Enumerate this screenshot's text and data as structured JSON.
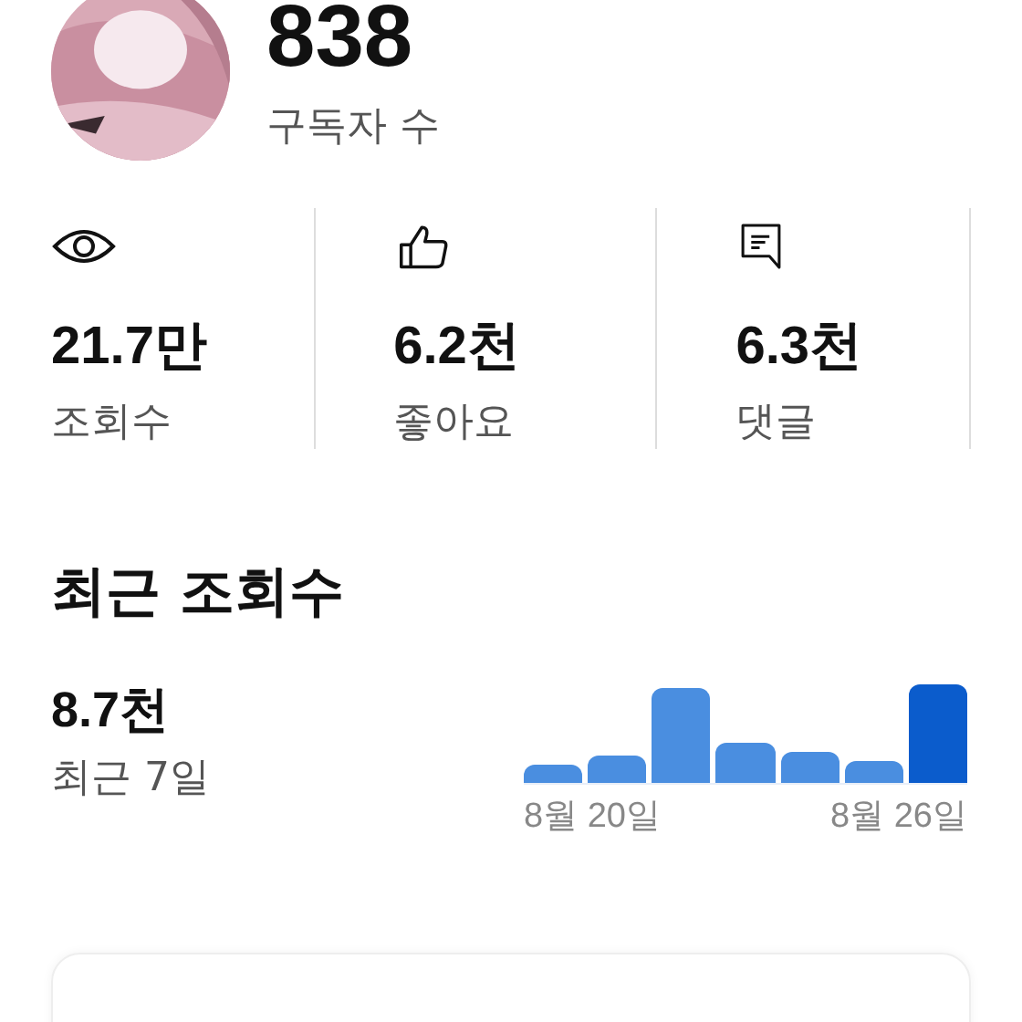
{
  "channel": {
    "subscribers": "838",
    "subscribers_label": "구독자 수"
  },
  "stats": [
    {
      "kind": "views",
      "value": "21.7만",
      "label": "조회수"
    },
    {
      "kind": "likes",
      "value": "6.2천",
      "label": "좋아요"
    },
    {
      "kind": "comments",
      "value": "6.3천",
      "label": "댓글"
    }
  ],
  "recent": {
    "title": "최근 조회수",
    "value": "8.7천",
    "period": "최근 7일",
    "chart_labels": [
      "8월 20일",
      "8월 26일"
    ]
  }
}
